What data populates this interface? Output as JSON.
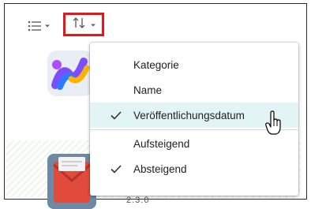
{
  "toolbar": {
    "view_icon": "list-icon",
    "sort_icon": "sort-arrows-icon",
    "highlight_color": "#e3171c"
  },
  "sort_menu": {
    "items": [
      {
        "label": "Kategorie",
        "checked": false,
        "active": false
      },
      {
        "label": "Name",
        "checked": false,
        "active": false
      },
      {
        "label": "Veröffentlichungsdatum",
        "checked": true,
        "active": true
      },
      {
        "label": "Aufsteigend",
        "checked": false,
        "active": false
      },
      {
        "label": "Absteigend",
        "checked": true,
        "active": false
      }
    ]
  },
  "app_list": {
    "version_partial": "2.3.0"
  }
}
